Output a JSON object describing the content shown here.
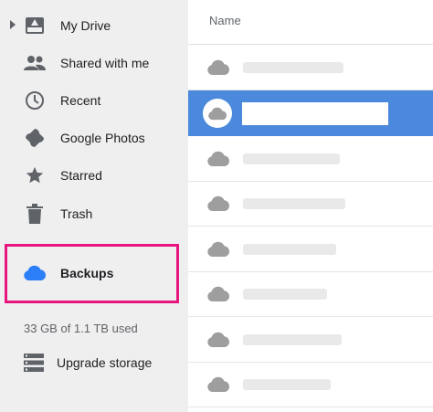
{
  "sidebar": {
    "items": [
      {
        "label": "My Drive",
        "icon": "drive-icon"
      },
      {
        "label": "Shared with me",
        "icon": "people-icon"
      },
      {
        "label": "Recent",
        "icon": "clock-icon"
      },
      {
        "label": "Google Photos",
        "icon": "pinwheel-icon"
      },
      {
        "label": "Starred",
        "icon": "star-icon"
      },
      {
        "label": "Trash",
        "icon": "trash-icon"
      }
    ],
    "backups": {
      "label": "Backups",
      "icon": "cloud-icon"
    },
    "storage": "33 GB of 1.1 TB used",
    "upgrade": "Upgrade storage"
  },
  "main": {
    "column_header": "Name",
    "row_count": 8,
    "selected_row": 1
  },
  "colors": {
    "selection": "#4a89dc",
    "highlight_border": "#e8157f",
    "backups_icon": "#2d7ff9",
    "icon_gray": "#5f6368",
    "row_cloud": "#9e9e9e"
  }
}
